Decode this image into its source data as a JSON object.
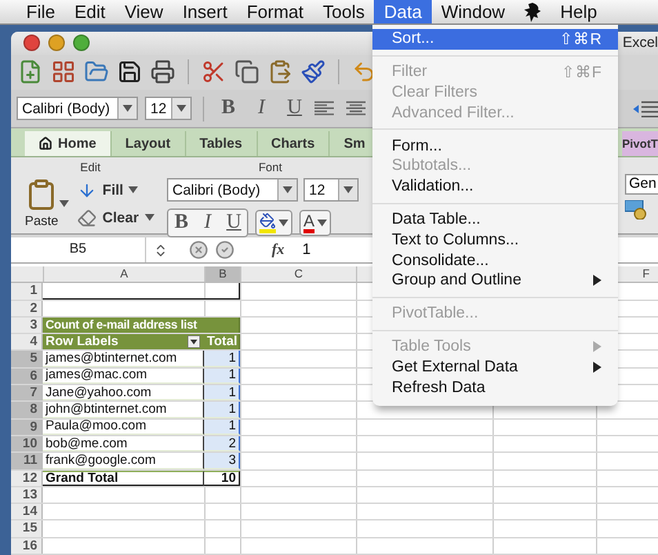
{
  "menu_bar": {
    "items": [
      {
        "kind": "text",
        "label": "File",
        "selected": false
      },
      {
        "kind": "text",
        "label": "Edit",
        "selected": false
      },
      {
        "kind": "text",
        "label": "View",
        "selected": false
      },
      {
        "kind": "text",
        "label": "Insert",
        "selected": false
      },
      {
        "kind": "text",
        "label": "Format",
        "selected": false
      },
      {
        "kind": "text",
        "label": "Tools",
        "selected": false
      },
      {
        "kind": "text",
        "label": "Data",
        "selected": true
      },
      {
        "kind": "text",
        "label": "Window",
        "selected": false
      },
      {
        "kind": "script",
        "selected": false
      },
      {
        "kind": "text",
        "label": "Help",
        "selected": false
      }
    ]
  },
  "window": {
    "title": "Excel"
  },
  "format_bar": {
    "font": "Calibri (Body)",
    "size": "12",
    "bold": "B",
    "italic": "I",
    "underline": "U"
  },
  "ribbon": {
    "tabs": [
      {
        "label": "Home",
        "kind": "home",
        "selected": true
      },
      {
        "label": "Layout",
        "kind": "standard",
        "selected": false
      },
      {
        "label": "Tables",
        "kind": "standard",
        "selected": false
      },
      {
        "label": "Charts",
        "kind": "standard",
        "selected": false
      },
      {
        "label": "Sm",
        "kind": "standard",
        "selected": false
      },
      {
        "label": "PivotT",
        "kind": "contextual",
        "selected": false
      }
    ],
    "edit_label": "Edit",
    "font_label": "Font",
    "paste": "Paste",
    "fill": "Fill",
    "clear": "Clear",
    "font": "Calibri (Body)",
    "size": "12",
    "bold": "B",
    "italic": "I",
    "underline": "U",
    "font_color": "A",
    "number_format": "Gen"
  },
  "formula_bar": {
    "cell": "B5",
    "fx": "fx",
    "value": "1"
  },
  "sheet": {
    "columns": [
      {
        "label": "A",
        "selected": false
      },
      {
        "label": "B",
        "selected": true
      },
      {
        "label": "C",
        "selected": false
      },
      {
        "label": "F",
        "selected": false
      }
    ],
    "rows": [
      {
        "number": "1",
        "selected": false,
        "kind": "outlined"
      },
      {
        "number": "2",
        "selected": false,
        "kind": "empty"
      },
      {
        "number": "3",
        "selected": false,
        "kind": "pivot_title",
        "a": "Count of e-mail address list"
      },
      {
        "number": "4",
        "selected": false,
        "kind": "pivot_header",
        "a": "Row Labels",
        "b": "Total"
      },
      {
        "number": "5",
        "selected": true,
        "kind": "data",
        "a": "james@btinternet.com",
        "b": "1"
      },
      {
        "number": "6",
        "selected": true,
        "kind": "data",
        "a": "james@mac.com",
        "b": "1"
      },
      {
        "number": "7",
        "selected": true,
        "kind": "data",
        "a": "Jane@yahoo.com",
        "b": "1"
      },
      {
        "number": "8",
        "selected": true,
        "kind": "data",
        "a": "john@btinternet.com",
        "b": "1"
      },
      {
        "number": "9",
        "selected": true,
        "kind": "data",
        "a": "Paula@moo.com",
        "b": "1"
      },
      {
        "number": "10",
        "selected": true,
        "kind": "data",
        "a": "bob@me.com",
        "b": "2"
      },
      {
        "number": "11",
        "selected": true,
        "kind": "data",
        "a": "frank@google.com",
        "b": "3"
      },
      {
        "number": "12",
        "selected": false,
        "kind": "total",
        "a": "Grand Total",
        "b": "10"
      },
      {
        "number": "13",
        "selected": false,
        "kind": "empty"
      },
      {
        "number": "14",
        "selected": false,
        "kind": "empty"
      },
      {
        "number": "15",
        "selected": false,
        "kind": "empty"
      },
      {
        "number": "16",
        "selected": false,
        "kind": "empty"
      }
    ]
  },
  "data_menu": {
    "items": [
      {
        "kind": "item",
        "label": "Sort...",
        "shortcut": "⇧⌘R",
        "disabled": false,
        "selected": true,
        "submenu": false
      },
      {
        "kind": "separator"
      },
      {
        "kind": "item",
        "label": "Filter",
        "shortcut": "⇧⌘F",
        "disabled": true,
        "selected": false,
        "submenu": false
      },
      {
        "kind": "item",
        "label": "Clear Filters",
        "disabled": true,
        "selected": false,
        "submenu": false
      },
      {
        "kind": "item",
        "label": "Advanced Filter...",
        "disabled": true,
        "selected": false,
        "submenu": false
      },
      {
        "kind": "separator"
      },
      {
        "kind": "item",
        "label": "Form...",
        "disabled": false,
        "selected": false,
        "submenu": false
      },
      {
        "kind": "item",
        "label": "Subtotals...",
        "disabled": true,
        "selected": false,
        "submenu": false
      },
      {
        "kind": "item",
        "label": "Validation...",
        "disabled": false,
        "selected": false,
        "submenu": false
      },
      {
        "kind": "separator"
      },
      {
        "kind": "item",
        "label": "Data Table...",
        "disabled": false,
        "selected": false,
        "submenu": false
      },
      {
        "kind": "item",
        "label": "Text to Columns...",
        "disabled": false,
        "selected": false,
        "submenu": false
      },
      {
        "kind": "item",
        "label": "Consolidate...",
        "disabled": false,
        "selected": false,
        "submenu": false
      },
      {
        "kind": "item",
        "label": "Group and Outline",
        "disabled": false,
        "selected": false,
        "submenu": true
      },
      {
        "kind": "separator"
      },
      {
        "kind": "item",
        "label": "PivotTable...",
        "disabled": true,
        "selected": false,
        "submenu": false
      },
      {
        "kind": "separator"
      },
      {
        "kind": "item",
        "label": "Table Tools",
        "disabled": true,
        "selected": false,
        "submenu": true
      },
      {
        "kind": "item",
        "label": "Get External Data",
        "disabled": false,
        "selected": false,
        "submenu": true
      },
      {
        "kind": "item",
        "label": "Refresh Data",
        "disabled": false,
        "selected": false,
        "submenu": false
      }
    ]
  }
}
